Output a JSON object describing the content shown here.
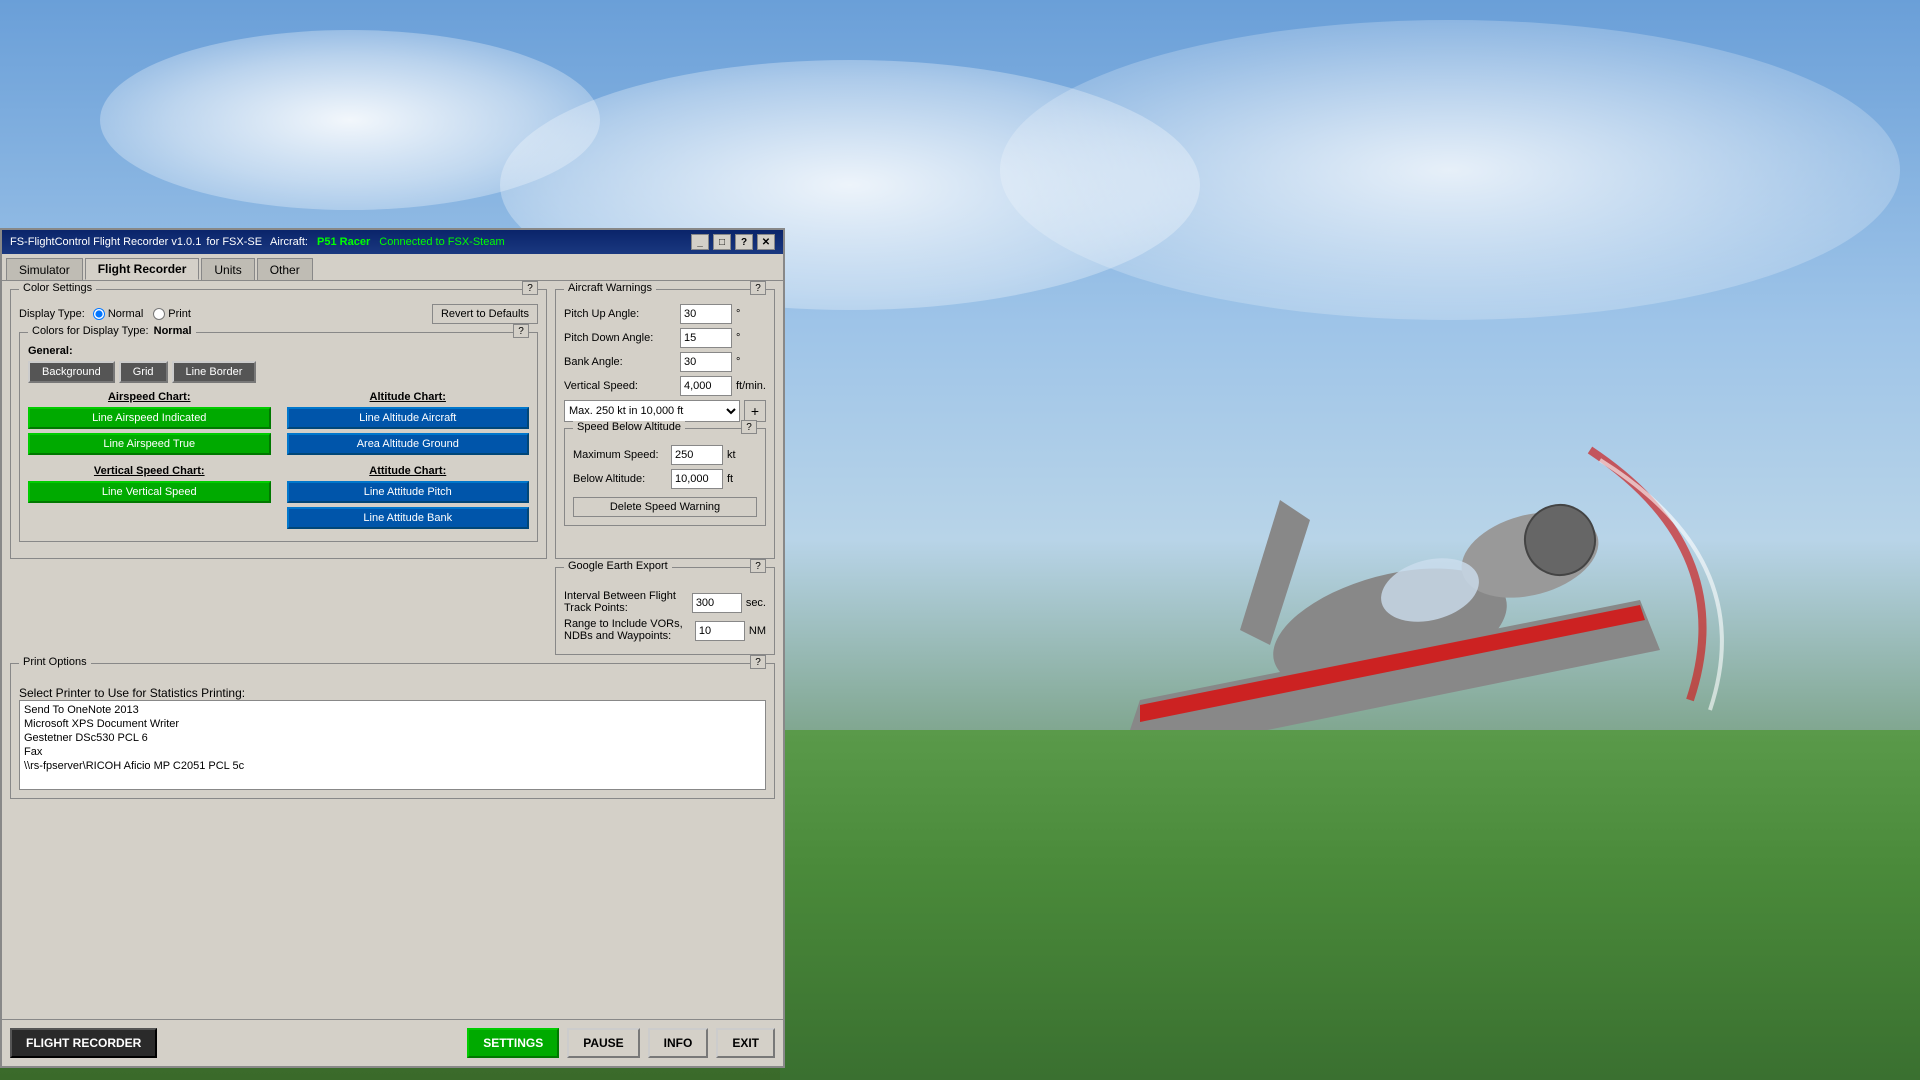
{
  "titleBar": {
    "appName": "FS-FlightControl Flight Recorder v1.0.1",
    "forText": "for FSX-SE",
    "aircraft": "Aircraft:",
    "aircraftName": "P51 Racer",
    "connectedText": "Connected to FSX-Steam",
    "minimizeIcon": "_",
    "maximizeIcon": "□",
    "helpIcon": "?",
    "closeIcon": "✕"
  },
  "tabs": [
    {
      "label": "Simulator",
      "active": false
    },
    {
      "label": "Flight Recorder",
      "active": true
    },
    {
      "label": "Units",
      "active": false
    },
    {
      "label": "Other",
      "active": false
    }
  ],
  "colorSettings": {
    "panelTitle": "Color Settings",
    "displayTypeLabel": "Display Type:",
    "radioNormal": "Normal",
    "radioPrint": "Print",
    "revertBtn": "Revert to Defaults",
    "colorsForLabel": "Colors for Display Type:",
    "colorsForType": "Normal",
    "generalLabel": "General:",
    "backgroundBtn": "Background",
    "gridBtn": "Grid",
    "lineBorderBtn": "Line Border",
    "airspeedChartTitle": "Airspeed Chart:",
    "lineAirspeedIndicatedBtn": "Line Airspeed Indicated",
    "lineAirspeedTrueBtn": "Line Airspeed True",
    "altitudeChartTitle": "Altitude Chart:",
    "lineAltitudeAircraftBtn": "Line Altitude Aircraft",
    "areaAltitudeGroundBtn": "Area Altitude Ground",
    "verticalSpeedChartTitle": "Vertical Speed Chart:",
    "lineVerticalSpeedBtn": "Line Vertical Speed",
    "attitudeChartTitle": "Attitude Chart:",
    "lineAttitudePitchBtn": "Line Attitude Pitch",
    "lineAttitudeBankBtn": "Line Attitude Bank"
  },
  "aircraftWarnings": {
    "panelTitle": "Aircraft Warnings",
    "pitchUpAngleLabel": "Pitch Up Angle:",
    "pitchUpValue": "30",
    "pitchUpUnit": "°",
    "pitchDownAngleLabel": "Pitch Down Angle:",
    "pitchDownValue": "15",
    "pitchDownUnit": "°",
    "bankAngleLabel": "Bank Angle:",
    "bankAngleValue": "30",
    "bankAngleUnit": "°",
    "verticalSpeedLabel": "Vertical Speed:",
    "verticalSpeedValue": "4,000",
    "verticalSpeedUnit": "ft/min.",
    "speedWarningDropdown": "Max. 250 kt in 10,000 ft",
    "addBtnLabel": "+",
    "speedBelowTitle": "Speed Below Altitude",
    "maximumSpeedLabel": "Maximum Speed:",
    "maximumSpeedValue": "250",
    "maximumSpeedUnit": "kt",
    "belowAltitudeLabel": "Below Altitude:",
    "belowAltitudeValue": "10,000",
    "belowAltitudeUnit": "ft",
    "deleteSpeedWarningBtn": "Delete Speed Warning"
  },
  "googleEarth": {
    "panelTitle": "Google Earth Export",
    "intervalLabel": "Interval Between Flight Track Points:",
    "intervalValue": "300",
    "intervalUnit": "sec.",
    "rangeLabel": "Range to Include VORs, NDBs and Waypoints:",
    "rangeValue": "10",
    "rangeUnit": "NM"
  },
  "printOptions": {
    "panelTitle": "Print Options",
    "selectPrinterLabel": "Select Printer to Use for Statistics Printing:",
    "printers": [
      "Send To OneNote 2013",
      "Microsoft XPS Document Writer",
      "Gestetner DSc530 PCL 6",
      "Fax",
      "\\\\rs-fpserver\\RICOH Aficio MP C2051 PCL 5c"
    ]
  },
  "bottomToolbar": {
    "flightRecorderBtn": "FLIGHT RECORDER",
    "settingsBtn": "SETTINGS",
    "pauseBtn": "PAUSE",
    "infoBtn": "INFO",
    "exitBtn": "EXIT"
  }
}
